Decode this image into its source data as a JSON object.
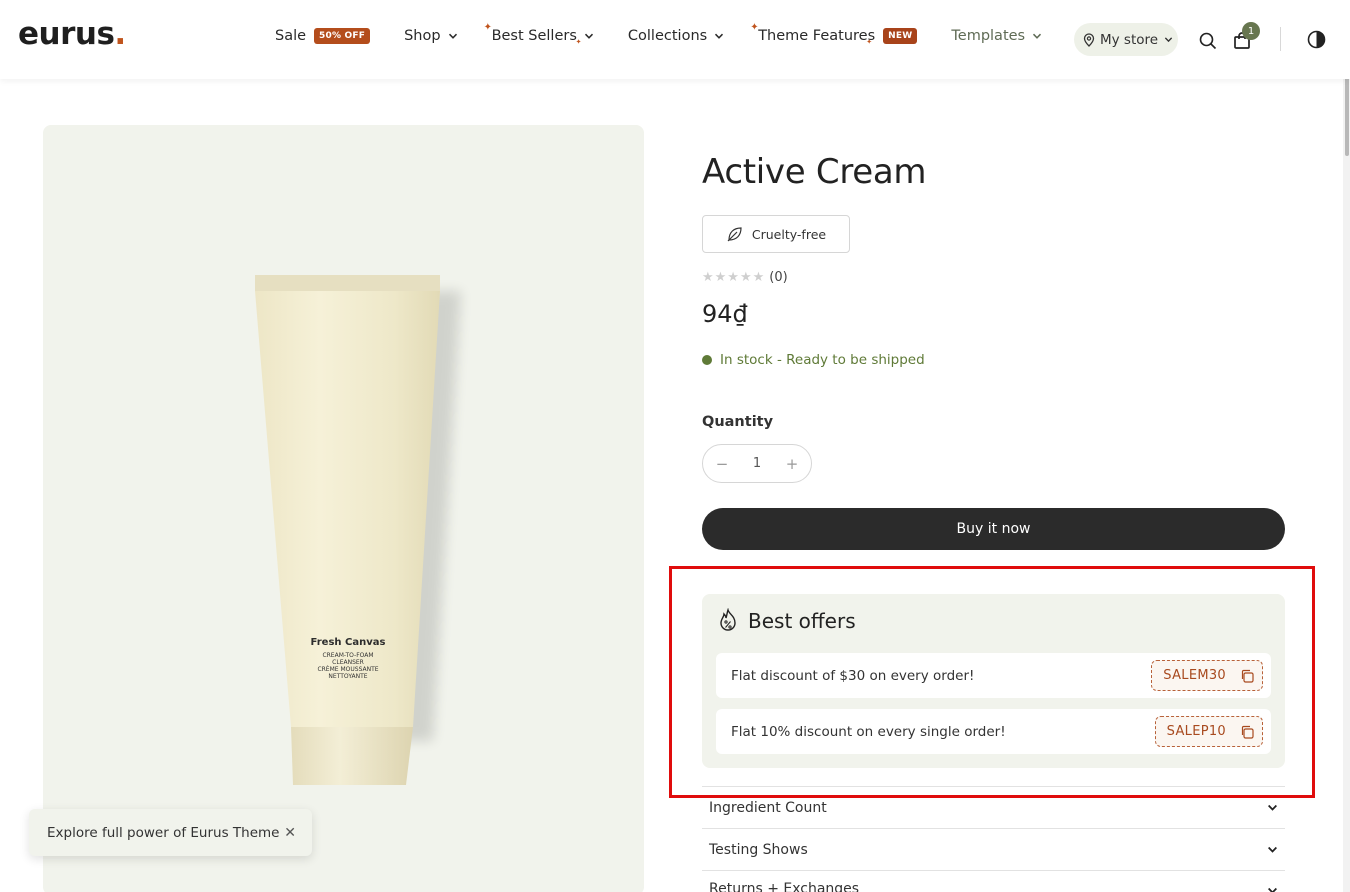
{
  "header": {
    "logo_text": "eurus",
    "logo_dot": ".",
    "nav": [
      {
        "label": "Sale",
        "badge": "50% OFF"
      },
      {
        "label": "Shop"
      },
      {
        "label": "Best Sellers"
      },
      {
        "label": "Collections"
      },
      {
        "label": "Theme Features",
        "badge": "NEW"
      },
      {
        "label": "Templates"
      }
    ],
    "store_label": "My store",
    "cart_count": "1"
  },
  "product": {
    "title": "Active Cream",
    "tag": "Cruelty-free",
    "rating_count": "(0)",
    "price": "94₫",
    "stock": "In stock - Ready to be shipped",
    "quantity_label": "Quantity",
    "quantity_value": "1",
    "buy_label": "Buy it now",
    "image": {
      "brand": "Fresh Canvas",
      "line1": "CREAM-TO-FOAM",
      "line2": "CLEANSER",
      "line3": "CRÈME MOUSSANTE",
      "line4": "NETTOYANTE"
    }
  },
  "offers": {
    "title": "Best offers",
    "items": [
      {
        "text": "Flat discount of $30 on every order!",
        "code": "SALEM30"
      },
      {
        "text": "Flat 10% discount on every single order!",
        "code": "SALEP10"
      }
    ]
  },
  "accordion": [
    {
      "label": "Ingredient Count"
    },
    {
      "label": "Testing Shows"
    },
    {
      "label": "Returns + Exchanges"
    }
  ],
  "toast": {
    "text": "Explore full power of Eurus Theme"
  },
  "colors": {
    "accent": "#c0541d",
    "stock_green": "#5f7a37",
    "highlight": "#e00c0c"
  }
}
